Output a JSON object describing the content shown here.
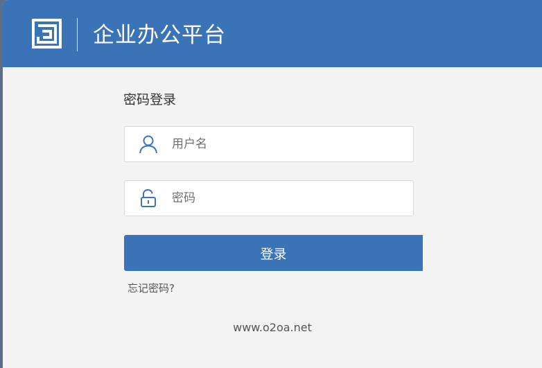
{
  "header": {
    "app_title": "企业办公平台",
    "logo_icon": "o2oa-logo-icon",
    "background_color": "#3b73b7"
  },
  "login": {
    "title": "密码登录",
    "username": {
      "placeholder": "用户名",
      "value": "",
      "icon": "user-icon"
    },
    "password": {
      "placeholder": "密码",
      "value": "",
      "icon": "lock-icon"
    },
    "submit_label": "登录",
    "forgot_label": "忘记密码?"
  },
  "footer": {
    "site": "www.o2oa.net"
  }
}
